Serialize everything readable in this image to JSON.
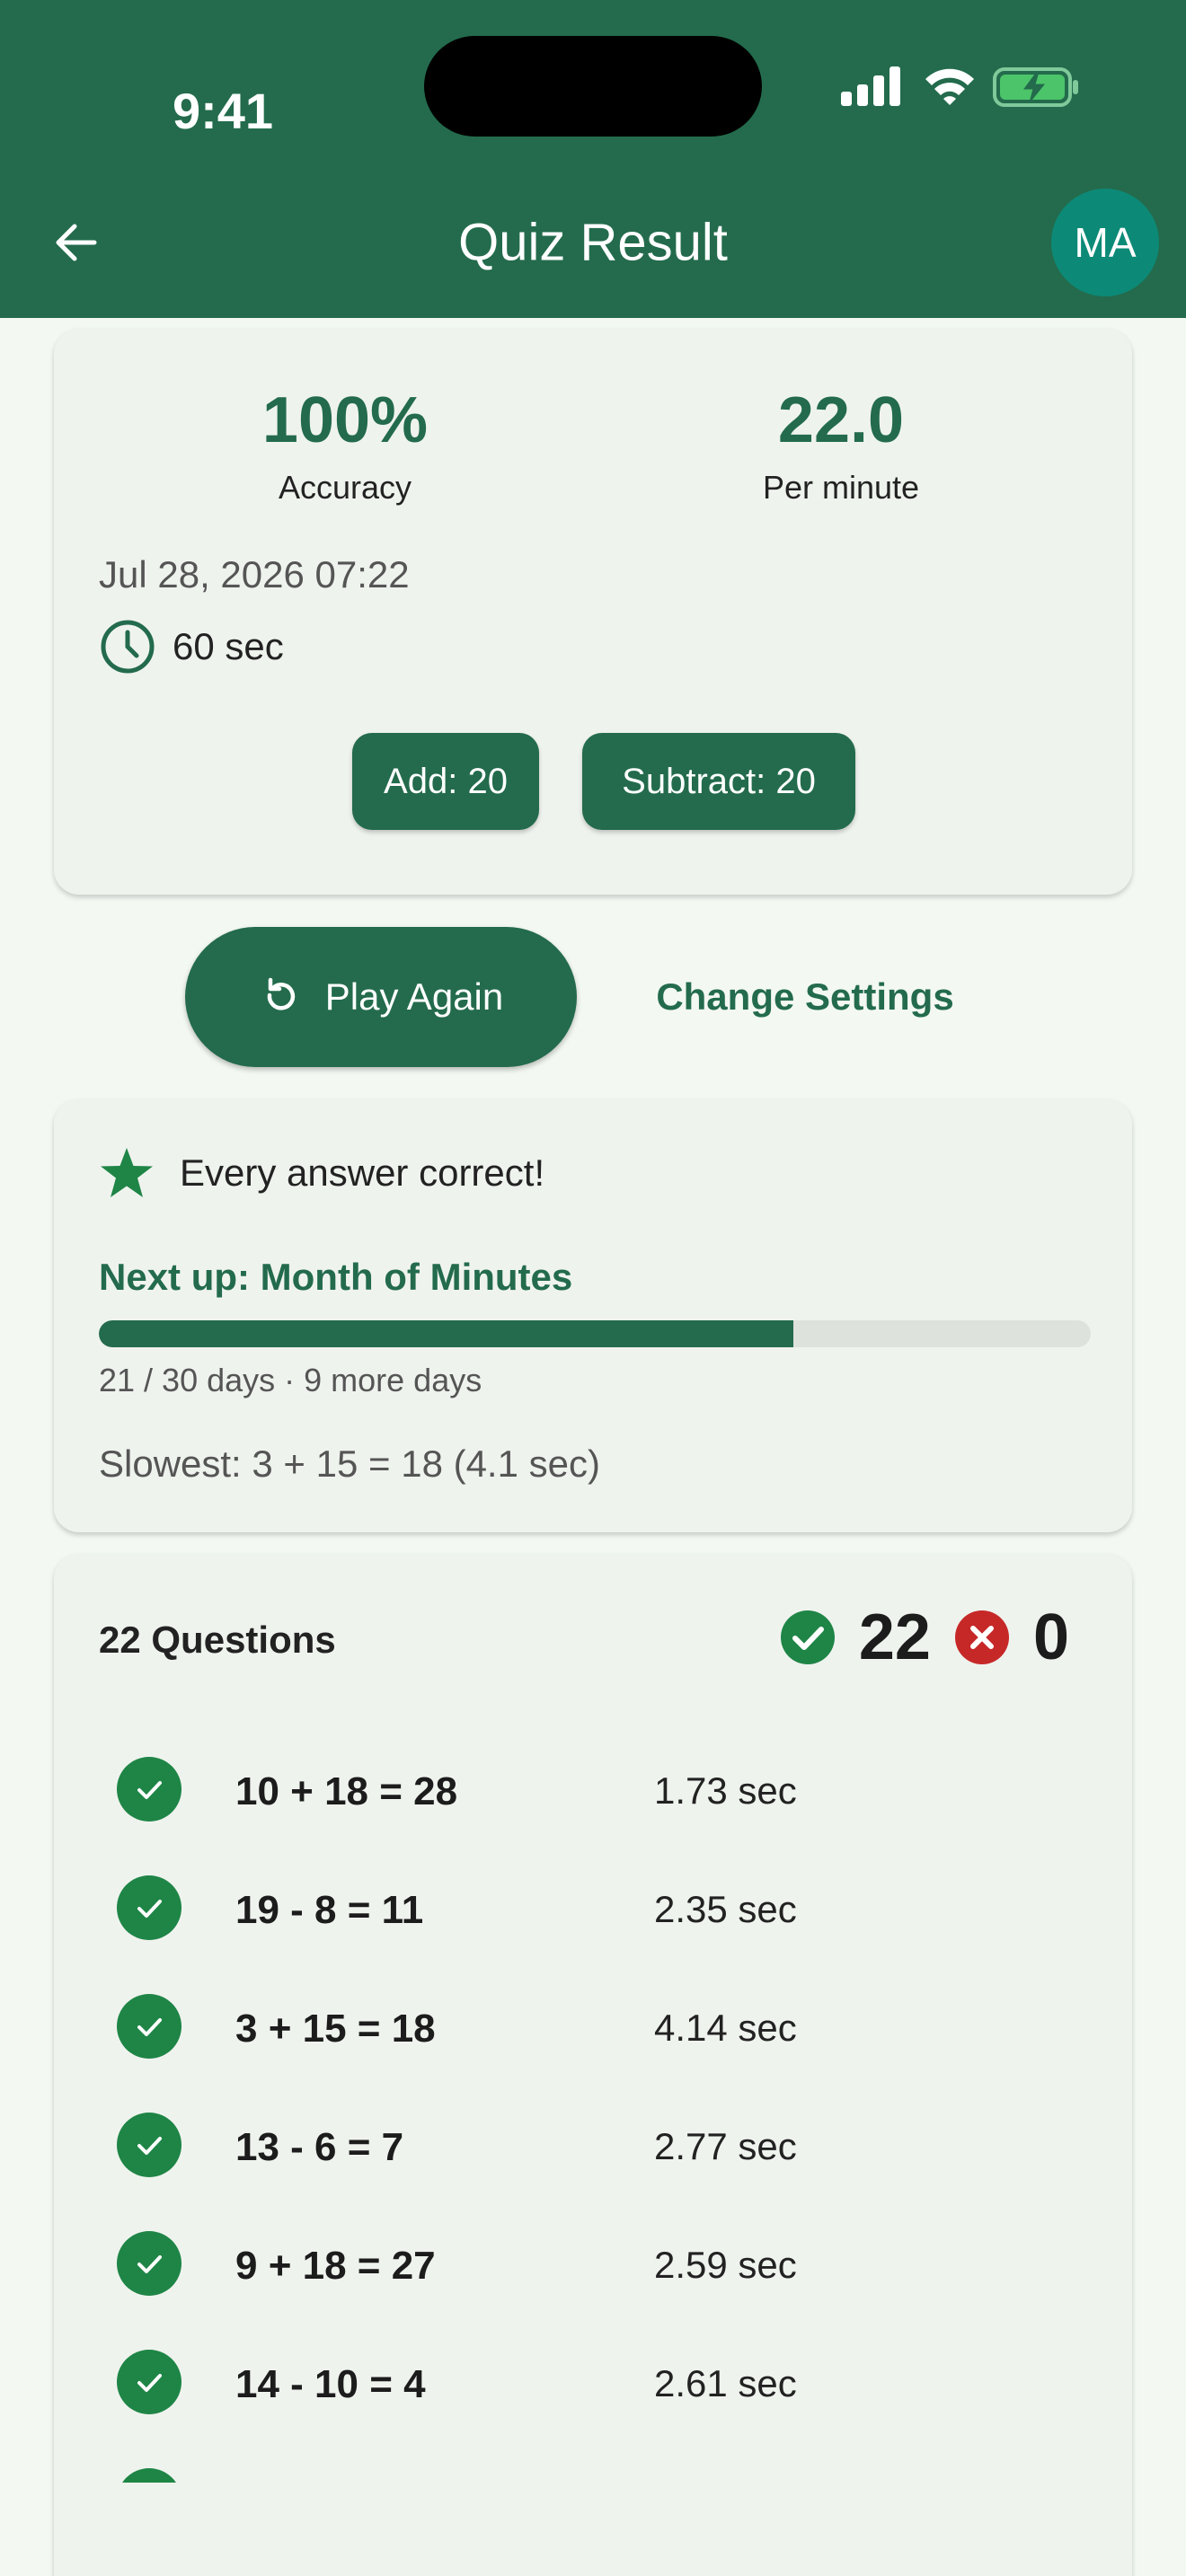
{
  "status_bar": {
    "time": "9:41"
  },
  "header": {
    "title": "Quiz Result",
    "avatar_initials": "MA"
  },
  "summary": {
    "accuracy_value": "100%",
    "accuracy_label": "Accuracy",
    "rate_value": "22.0",
    "rate_label": "Per minute",
    "date": "Jul 28, 2026 07:22",
    "duration": "60 sec",
    "chips": [
      "Add: 20",
      "Subtract: 20"
    ]
  },
  "actions": {
    "play_again": "Play Again",
    "change_settings": "Change Settings"
  },
  "progress": {
    "message": "Every answer correct!",
    "next_up": "Next up: Month of Minutes",
    "current": 21,
    "total": 30,
    "progress_text": "21 / 30 days  ·  9 more days",
    "slowest": "Slowest: 3 + 15 = 18 (4.1 sec)"
  },
  "questions": {
    "title": "22 Questions",
    "correct_count": "22",
    "wrong_count": "0",
    "items": [
      {
        "expr": "10 + 18 = 28",
        "time": "1.73 sec"
      },
      {
        "expr": "19 - 8 = 11",
        "time": "2.35 sec"
      },
      {
        "expr": "3 + 15 = 18",
        "time": "4.14 sec"
      },
      {
        "expr": "13 - 6 = 7",
        "time": "2.77 sec"
      },
      {
        "expr": "9 + 18 = 27",
        "time": "2.59 sec"
      },
      {
        "expr": "14 - 10 = 4",
        "time": "2.61 sec"
      }
    ]
  },
  "colors": {
    "primary": "#236b4c",
    "success": "#1e8546",
    "error": "#c62828",
    "avatar": "#0c8a77",
    "background": "#f3f8f2"
  }
}
